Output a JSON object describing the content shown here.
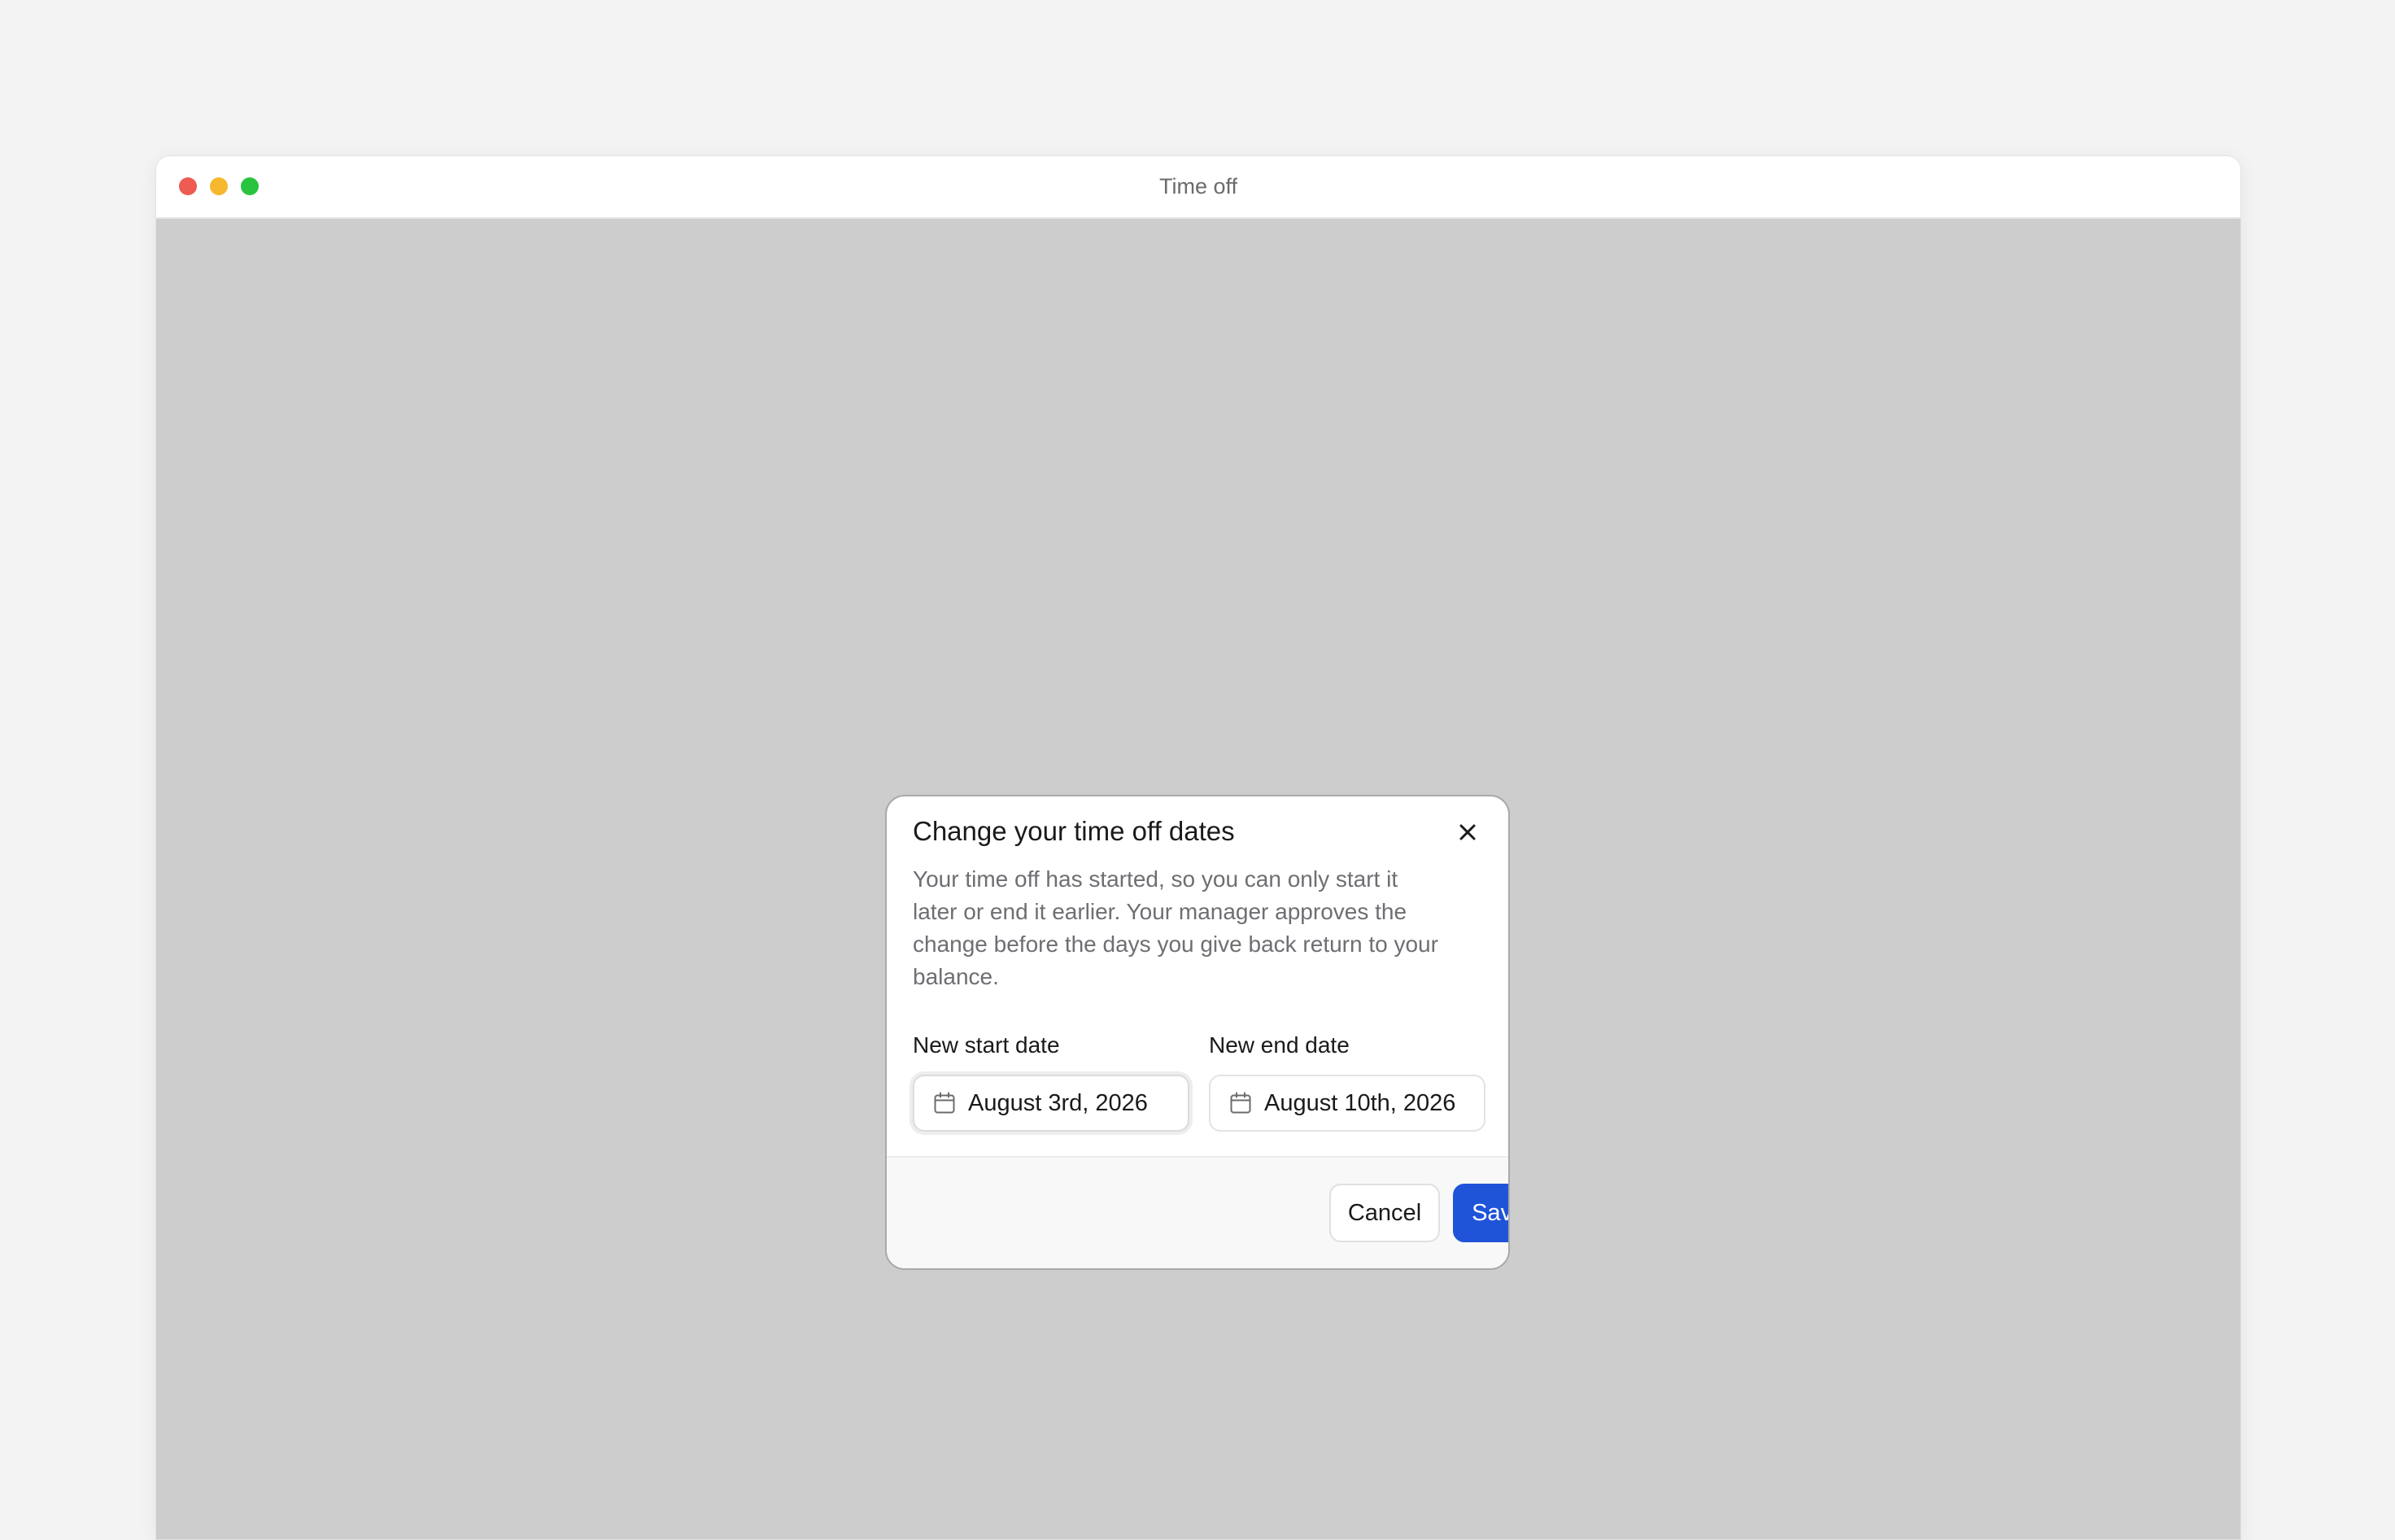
{
  "window": {
    "title": "Time off",
    "traffic_colors": {
      "close": "#ed5b52",
      "minimize": "#f5b82e",
      "maximize": "#2ac33f"
    }
  },
  "dialog": {
    "title": "Change your time off dates",
    "description": "Your time off has started, so you can only start it later or end it earlier. Your manager approves the change before the days you give back return to your balance.",
    "close_icon": "close-icon",
    "start": {
      "label": "New start date",
      "value": "August 3rd, 2026",
      "icon": "calendar-icon"
    },
    "end": {
      "label": "New end date",
      "value": "August 10th, 2026",
      "icon": "calendar-icon"
    },
    "buttons": {
      "cancel": "Cancel",
      "save": "Save changes"
    },
    "colors": {
      "primary": "#1f54d8",
      "overlay": "#cdcdcd"
    }
  }
}
